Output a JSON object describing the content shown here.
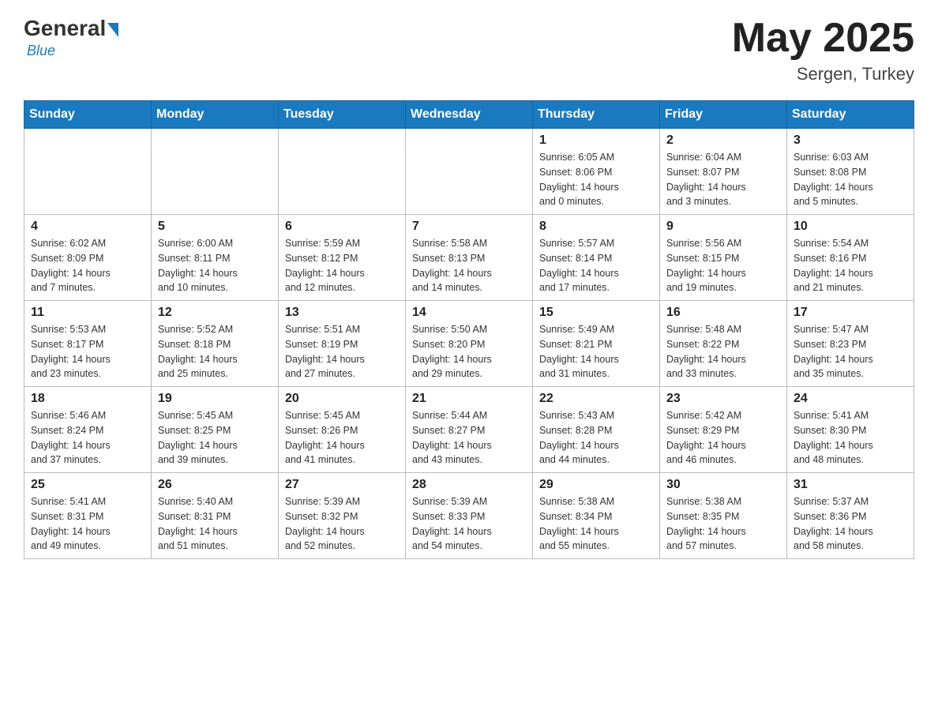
{
  "header": {
    "logo": {
      "general": "General",
      "blue": "Blue",
      "subtitle": "Blue"
    },
    "title": "May 2025",
    "location": "Sergen, Turkey"
  },
  "calendar": {
    "days_of_week": [
      "Sunday",
      "Monday",
      "Tuesday",
      "Wednesday",
      "Thursday",
      "Friday",
      "Saturday"
    ],
    "weeks": [
      [
        {
          "day": "",
          "info": ""
        },
        {
          "day": "",
          "info": ""
        },
        {
          "day": "",
          "info": ""
        },
        {
          "day": "",
          "info": ""
        },
        {
          "day": "1",
          "info": "Sunrise: 6:05 AM\nSunset: 8:06 PM\nDaylight: 14 hours\nand 0 minutes."
        },
        {
          "day": "2",
          "info": "Sunrise: 6:04 AM\nSunset: 8:07 PM\nDaylight: 14 hours\nand 3 minutes."
        },
        {
          "day": "3",
          "info": "Sunrise: 6:03 AM\nSunset: 8:08 PM\nDaylight: 14 hours\nand 5 minutes."
        }
      ],
      [
        {
          "day": "4",
          "info": "Sunrise: 6:02 AM\nSunset: 8:09 PM\nDaylight: 14 hours\nand 7 minutes."
        },
        {
          "day": "5",
          "info": "Sunrise: 6:00 AM\nSunset: 8:11 PM\nDaylight: 14 hours\nand 10 minutes."
        },
        {
          "day": "6",
          "info": "Sunrise: 5:59 AM\nSunset: 8:12 PM\nDaylight: 14 hours\nand 12 minutes."
        },
        {
          "day": "7",
          "info": "Sunrise: 5:58 AM\nSunset: 8:13 PM\nDaylight: 14 hours\nand 14 minutes."
        },
        {
          "day": "8",
          "info": "Sunrise: 5:57 AM\nSunset: 8:14 PM\nDaylight: 14 hours\nand 17 minutes."
        },
        {
          "day": "9",
          "info": "Sunrise: 5:56 AM\nSunset: 8:15 PM\nDaylight: 14 hours\nand 19 minutes."
        },
        {
          "day": "10",
          "info": "Sunrise: 5:54 AM\nSunset: 8:16 PM\nDaylight: 14 hours\nand 21 minutes."
        }
      ],
      [
        {
          "day": "11",
          "info": "Sunrise: 5:53 AM\nSunset: 8:17 PM\nDaylight: 14 hours\nand 23 minutes."
        },
        {
          "day": "12",
          "info": "Sunrise: 5:52 AM\nSunset: 8:18 PM\nDaylight: 14 hours\nand 25 minutes."
        },
        {
          "day": "13",
          "info": "Sunrise: 5:51 AM\nSunset: 8:19 PM\nDaylight: 14 hours\nand 27 minutes."
        },
        {
          "day": "14",
          "info": "Sunrise: 5:50 AM\nSunset: 8:20 PM\nDaylight: 14 hours\nand 29 minutes."
        },
        {
          "day": "15",
          "info": "Sunrise: 5:49 AM\nSunset: 8:21 PM\nDaylight: 14 hours\nand 31 minutes."
        },
        {
          "day": "16",
          "info": "Sunrise: 5:48 AM\nSunset: 8:22 PM\nDaylight: 14 hours\nand 33 minutes."
        },
        {
          "day": "17",
          "info": "Sunrise: 5:47 AM\nSunset: 8:23 PM\nDaylight: 14 hours\nand 35 minutes."
        }
      ],
      [
        {
          "day": "18",
          "info": "Sunrise: 5:46 AM\nSunset: 8:24 PM\nDaylight: 14 hours\nand 37 minutes."
        },
        {
          "day": "19",
          "info": "Sunrise: 5:45 AM\nSunset: 8:25 PM\nDaylight: 14 hours\nand 39 minutes."
        },
        {
          "day": "20",
          "info": "Sunrise: 5:45 AM\nSunset: 8:26 PM\nDaylight: 14 hours\nand 41 minutes."
        },
        {
          "day": "21",
          "info": "Sunrise: 5:44 AM\nSunset: 8:27 PM\nDaylight: 14 hours\nand 43 minutes."
        },
        {
          "day": "22",
          "info": "Sunrise: 5:43 AM\nSunset: 8:28 PM\nDaylight: 14 hours\nand 44 minutes."
        },
        {
          "day": "23",
          "info": "Sunrise: 5:42 AM\nSunset: 8:29 PM\nDaylight: 14 hours\nand 46 minutes."
        },
        {
          "day": "24",
          "info": "Sunrise: 5:41 AM\nSunset: 8:30 PM\nDaylight: 14 hours\nand 48 minutes."
        }
      ],
      [
        {
          "day": "25",
          "info": "Sunrise: 5:41 AM\nSunset: 8:31 PM\nDaylight: 14 hours\nand 49 minutes."
        },
        {
          "day": "26",
          "info": "Sunrise: 5:40 AM\nSunset: 8:31 PM\nDaylight: 14 hours\nand 51 minutes."
        },
        {
          "day": "27",
          "info": "Sunrise: 5:39 AM\nSunset: 8:32 PM\nDaylight: 14 hours\nand 52 minutes."
        },
        {
          "day": "28",
          "info": "Sunrise: 5:39 AM\nSunset: 8:33 PM\nDaylight: 14 hours\nand 54 minutes."
        },
        {
          "day": "29",
          "info": "Sunrise: 5:38 AM\nSunset: 8:34 PM\nDaylight: 14 hours\nand 55 minutes."
        },
        {
          "day": "30",
          "info": "Sunrise: 5:38 AM\nSunset: 8:35 PM\nDaylight: 14 hours\nand 57 minutes."
        },
        {
          "day": "31",
          "info": "Sunrise: 5:37 AM\nSunset: 8:36 PM\nDaylight: 14 hours\nand 58 minutes."
        }
      ]
    ]
  }
}
